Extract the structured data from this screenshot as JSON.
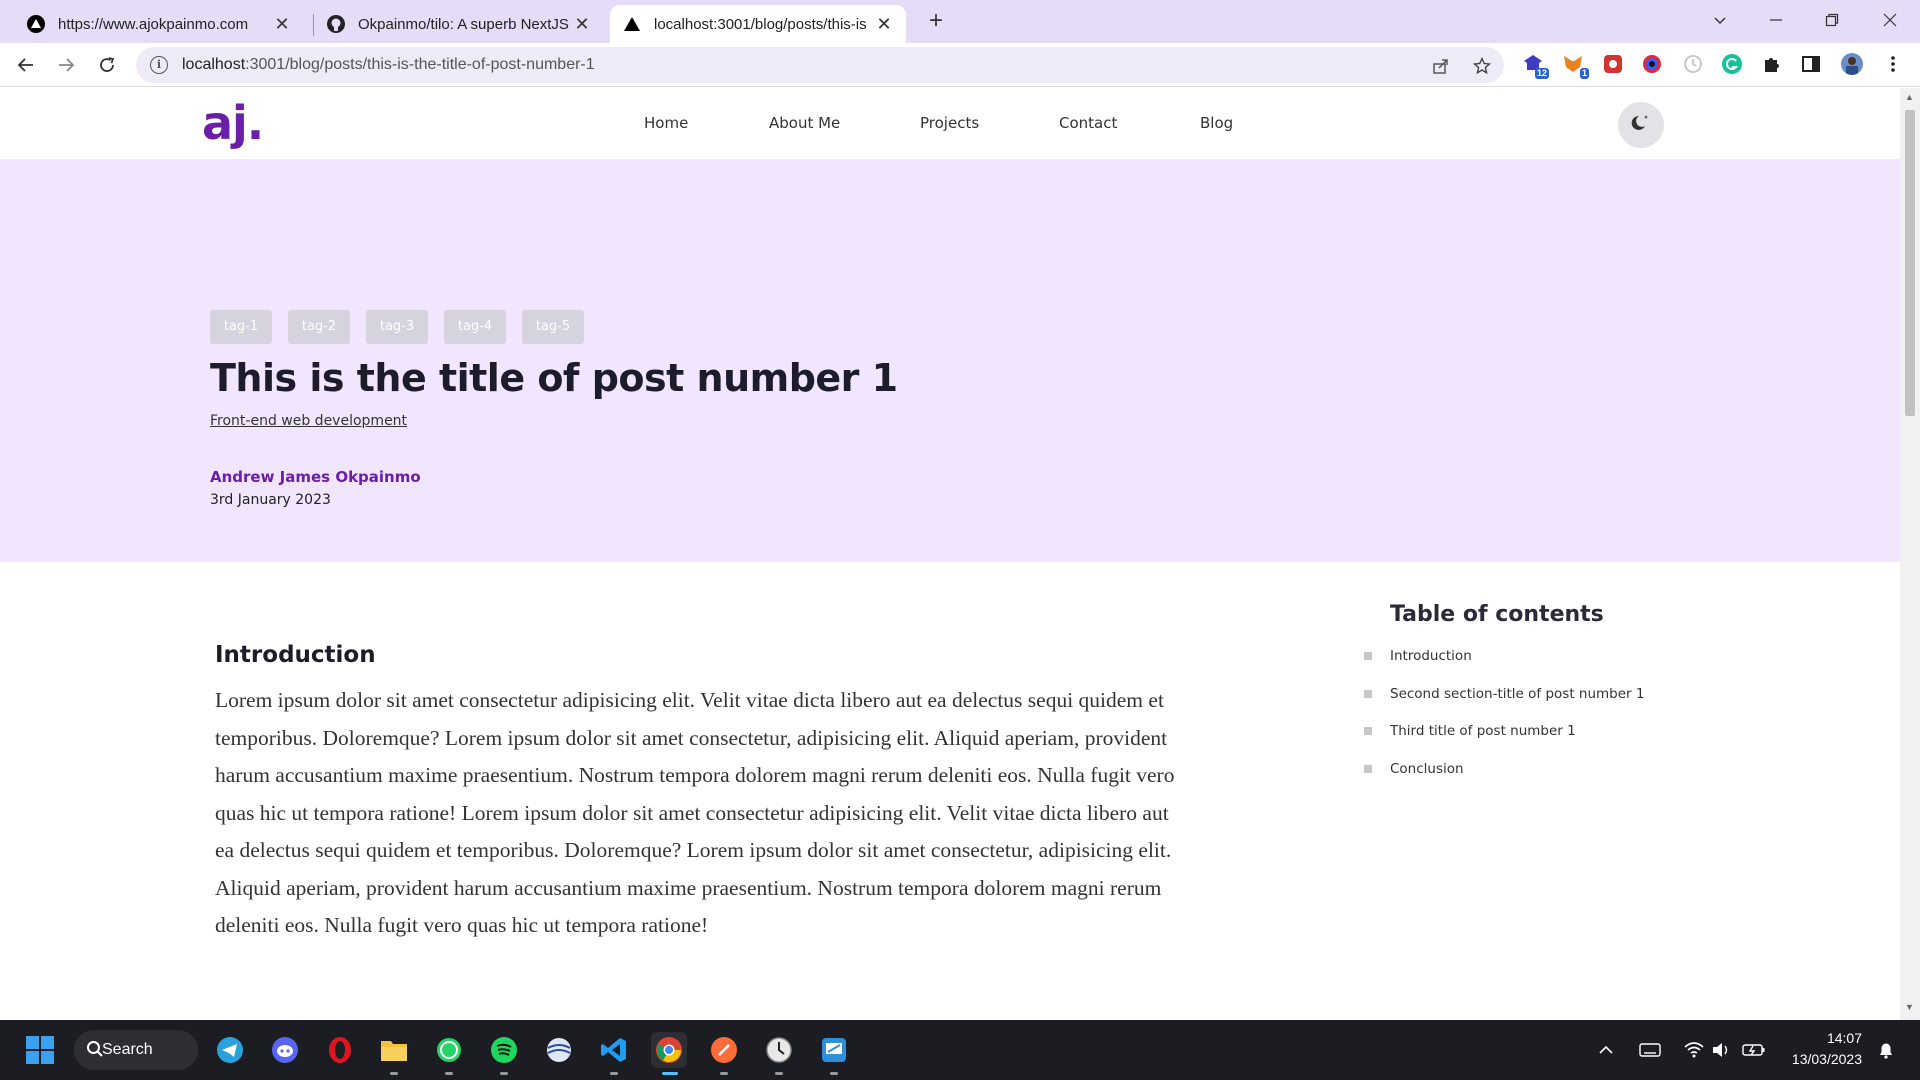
{
  "browser": {
    "tabs": [
      {
        "title": "https://www.ajokpainmo.com",
        "icon": "vercel-triangle-icon",
        "active": false
      },
      {
        "title": "Okpainmo/tilo: A superb NextJS",
        "icon": "github-icon",
        "active": false
      },
      {
        "title": "localhost:3001/blog/posts/this-is",
        "icon": "vercel-triangle-icon",
        "active": true
      }
    ],
    "new_tab": "+",
    "url_host": "localhost",
    "url_rest": ":3001/blog/posts/this-is-the-title-of-post-number-1",
    "extensions": [
      {
        "name": "extension-badge-icon",
        "color": "#3f3cc0",
        "badge": "12"
      },
      {
        "name": "metamask-icon",
        "color": "#e8831d",
        "badge": "1"
      },
      {
        "name": "extension-red-icon",
        "color": "#d0342c"
      },
      {
        "name": "extension-ring-icon",
        "color": "#6a2bd8"
      },
      {
        "name": "extension-timer-icon",
        "color": "#c9c9c9"
      },
      {
        "name": "grammarly-icon",
        "color": "#15c39a"
      }
    ]
  },
  "site": {
    "logo": "aj.",
    "nav": [
      "Home",
      "About Me",
      "Projects",
      "Contact",
      "Blog"
    ],
    "theme_toggle": "moon-icon"
  },
  "post": {
    "tags": [
      "tag-1",
      "tag-2",
      "tag-3",
      "tag-4",
      "tag-5"
    ],
    "title": "This is the title of post number 1",
    "category": "Front-end web development",
    "author": "Andrew James Okpainmo",
    "date": "3rd January 2023",
    "section_heading": "Introduction",
    "body": "Lorem ipsum dolor sit amet consectetur adipisicing elit. Velit vitae dicta libero aut ea delectus sequi quidem et temporibus. Doloremque? Lorem ipsum dolor sit amet consectetur, adipisicing elit. Aliquid aperiam, provident harum accusantium maxime praesentium. Nostrum tempora dolorem magni rerum deleniti eos. Nulla fugit vero quas hic ut tempora ratione! Lorem ipsum dolor sit amet consectetur adipisicing elit. Velit vitae dicta libero aut ea delectus sequi quidem et temporibus. Doloremque? Lorem ipsum dolor sit amet consectetur, adipisicing elit. Aliquid aperiam, provident harum accusantium maxime praesentium. Nostrum tempora dolorem magni rerum deleniti eos. Nulla fugit vero quas hic ut tempora ratione!"
  },
  "toc": {
    "title": "Table of contents",
    "items": [
      "Introduction",
      "Second section-title of post number 1",
      "Third title of post number 1",
      "Conclusion"
    ]
  },
  "taskbar": {
    "search_label": "Search",
    "apps": [
      "telegram-icon",
      "discord-icon",
      "opera-icon",
      "file-explorer-icon",
      "whatsapp-icon",
      "spotify-icon",
      "app-globe-icon",
      "vscode-icon",
      "chrome-icon",
      "postman-icon",
      "clock-app-icon",
      "remote-app-icon"
    ],
    "time": "14:07",
    "date": "13/03/2023"
  },
  "colors": {
    "brand": "#6b1fa8",
    "hero_bg": "#f1e6fd",
    "tab_strip": "#e6dcf7"
  }
}
